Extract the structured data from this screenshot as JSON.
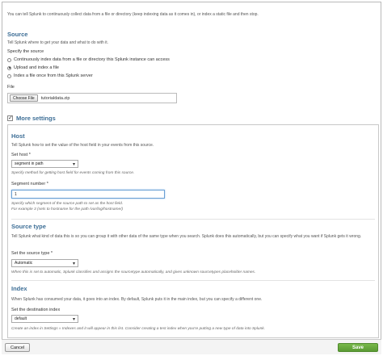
{
  "intro": "You can tell Splunk to continuously collect data from a file or directory (keep indexing data as it comes in), or index a static file and then stop.",
  "source": {
    "heading": "Source",
    "desc": "Tell Splunk where to get your data and what to do with it.",
    "specify_label": "Specify the source",
    "options": [
      {
        "label": "Continuously index data from a file or directory this Splunk instance can access",
        "selected": false
      },
      {
        "label": "Upload and index a file",
        "selected": true
      },
      {
        "label": "Index a file once from this Splunk server",
        "selected": false
      }
    ],
    "file_label": "File",
    "choose_file_button": "Choose File",
    "file_name": "tutorialdata.zip"
  },
  "more_settings": {
    "label": "More settings",
    "checked": true
  },
  "host": {
    "heading": "Host",
    "desc": "Tell Splunk how to set the value of the host field in your events from this source.",
    "set_host_label": "Set host *",
    "set_host_value": "segment in path",
    "set_host_hint": "Specify method for getting host field for events coming from this source.",
    "segment_label": "Segment number *",
    "segment_value": "1",
    "segment_hint1": "Specify which segment of the source path to set as the host field.",
    "segment_hint2": "For example 3 (sets to hostname for the path /var/log/hostname/)"
  },
  "source_type": {
    "heading": "Source type",
    "desc": "Tell Splunk what kind of data this is so you can group it with other data of the same type when you search. Splunk does this automatically, but you can specify what you want if Splunk gets it wrong.",
    "set_label": "Set the source type *",
    "set_value": "Automatic",
    "hint": "When this is set to automatic, Splunk classifies and assigns the sourcetype automatically, and gives unknown sourcetypes placeholder names."
  },
  "index": {
    "heading": "Index",
    "desc": "When Splunk has consumed your data, it goes into an index. By default, Splunk puts it in the main index, but you can specify a different one.",
    "set_label": "Set the destination index",
    "set_value": "default",
    "hint": "Create an index in Settings » Indexes and it will appear in this list. Consider creating a test index when you're putting a new type of data into Splunk."
  },
  "footer": {
    "cancel": "Cancel",
    "save": "Save"
  },
  "icons": {
    "caret": "chevron-down-icon",
    "check": "checkmark-icon"
  }
}
